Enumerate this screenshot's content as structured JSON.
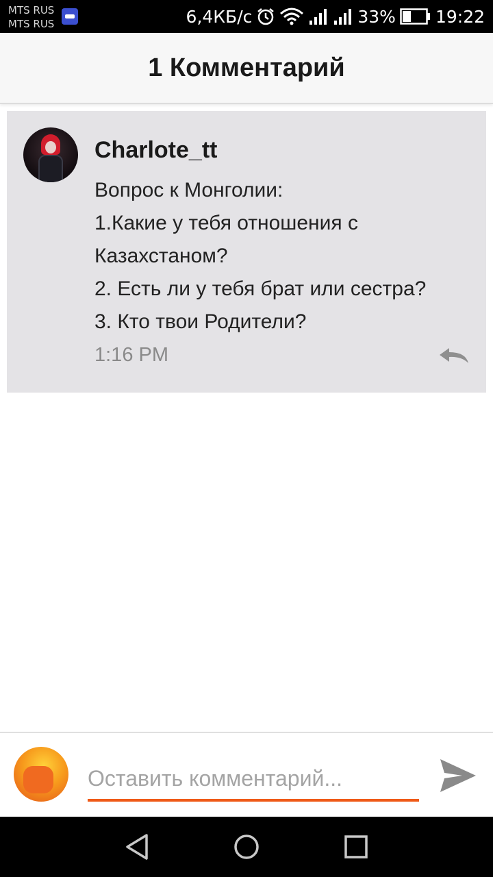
{
  "status_bar": {
    "carrier_1": "MTS RUS",
    "carrier_2": "MTS RUS",
    "network_speed": "6,4КБ/с",
    "battery_percent": "33%",
    "time": "19:22",
    "icons": [
      "app-notification-icon",
      "alarm-icon",
      "wifi-icon",
      "signal-icon",
      "signal-icon",
      "battery-icon"
    ]
  },
  "header": {
    "title": "1 Комментарий"
  },
  "comment": {
    "author": "Charlote_tt",
    "lines": [
      "Вопрос к Монголии:",
      "1.Какие у тебя отношения с",
      "Казахстаном?",
      "2. Есть ли у тебя брат или сестра?",
      "3. Кто твои Родители?"
    ],
    "timestamp": "1:16 PM",
    "reply_icon": "reply-icon"
  },
  "composer": {
    "placeholder": "Оставить комментарий...",
    "value": "",
    "send_icon": "send-icon",
    "accent_color": "#ef5a18"
  },
  "nav_bar": {
    "buttons": [
      "back-icon",
      "home-icon",
      "recents-icon"
    ]
  },
  "colors": {
    "card_background": "#e4e3e6",
    "header_background": "#f7f7f7",
    "accent": "#ef5a18"
  }
}
